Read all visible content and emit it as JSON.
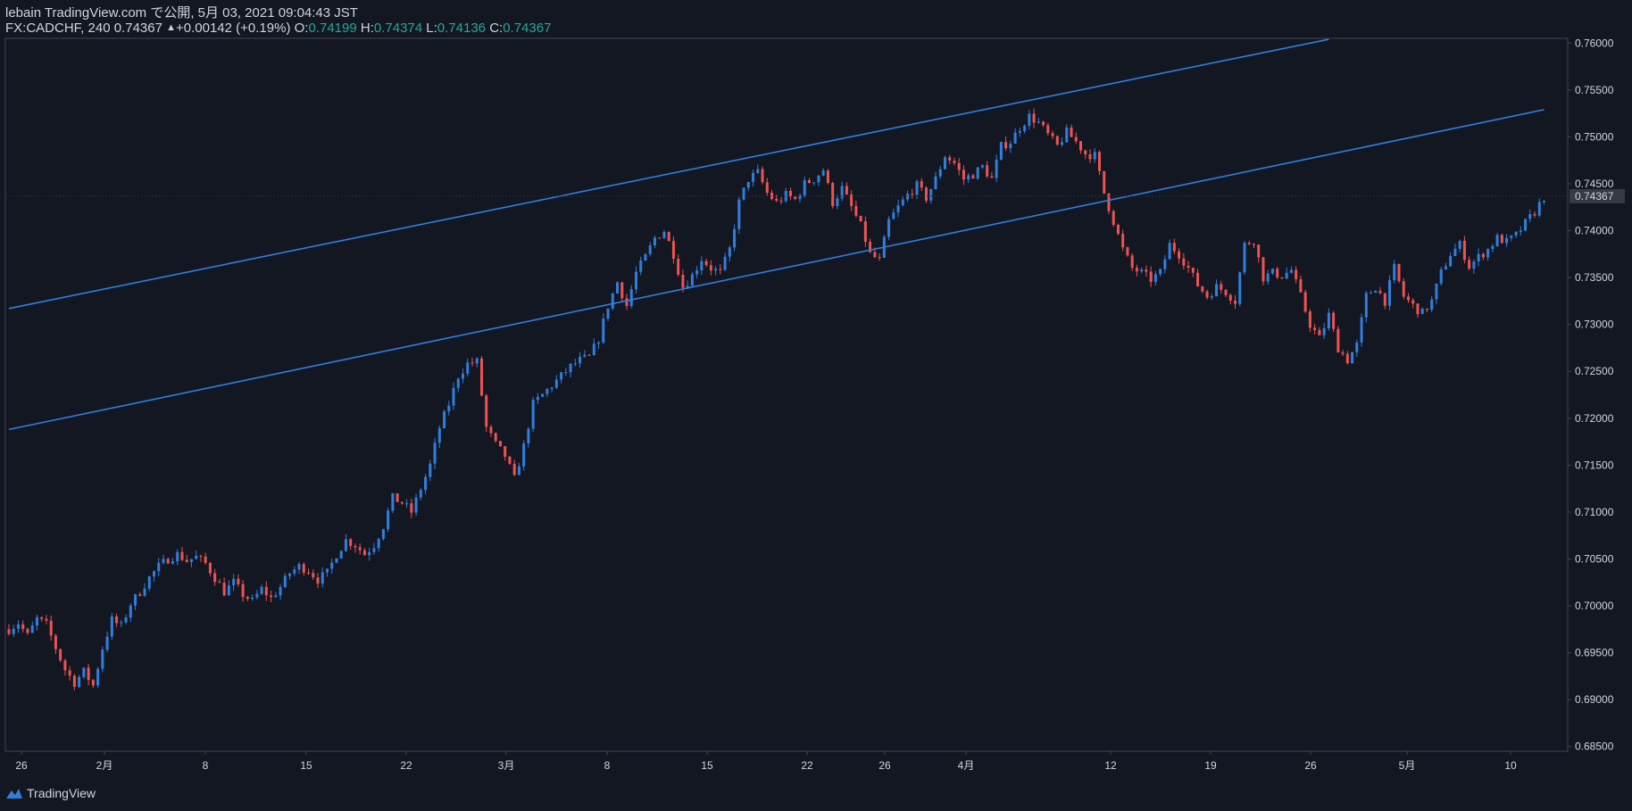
{
  "header": {
    "title": "lebain TradingView.com で公開, 5月 03, 2021 09:04:43 JST",
    "symbol_interval": "FX:CADCHF, 240",
    "last": "0.74367",
    "change": "+0.00142 (+0.19%)",
    "o_label": "O:",
    "o_value": "0.74199",
    "h_label": "H:",
    "h_value": "0.74374",
    "l_label": "L:",
    "l_value": "0.74136",
    "c_label": "C:",
    "c_value": "0.74367"
  },
  "footer": {
    "brand": "TradingView"
  },
  "colors": {
    "background": "#131722",
    "up": "#2f7fdf",
    "down": "#ef5350",
    "trendline": "#2f7fdf",
    "text": "#d1d4dc",
    "price_label_bg": "#363a45"
  },
  "chart_data": {
    "type": "candlestick",
    "symbol": "FX:CADCHF",
    "interval": "240",
    "y_range": [
      0.6845,
      0.7605
    ],
    "y_ticks": [
      "0.76000",
      "0.75500",
      "0.75000",
      "0.74500",
      "0.74000",
      "0.73500",
      "0.73000",
      "0.72500",
      "0.72000",
      "0.71500",
      "0.71000",
      "0.70500",
      "0.70000",
      "0.69500",
      "0.69000",
      "0.68500"
    ],
    "x_ticks": [
      "26",
      "2月",
      "8",
      "15",
      "22",
      "3月",
      "8",
      "15",
      "22",
      "26",
      "4月",
      "12",
      "19",
      "26",
      "5月",
      "10"
    ],
    "last_price_label": "0.74367",
    "close_path_note": "",
    "close_path": [
      [
        0,
        0.6975
      ],
      [
        2,
        0.6982
      ],
      [
        4,
        0.6968
      ],
      [
        6,
        0.6986
      ],
      [
        8,
        0.698
      ],
      [
        10,
        0.6955
      ],
      [
        12,
        0.6932
      ],
      [
        14,
        0.6918
      ],
      [
        16,
        0.693
      ],
      [
        18,
        0.6915
      ],
      [
        20,
        0.6955
      ],
      [
        22,
        0.6985
      ],
      [
        24,
        0.6978
      ],
      [
        26,
        0.7002
      ],
      [
        28,
        0.7015
      ],
      [
        30,
        0.703
      ],
      [
        32,
        0.7042
      ],
      [
        34,
        0.705
      ],
      [
        36,
        0.7055
      ],
      [
        38,
        0.7048
      ],
      [
        40,
        0.7052
      ],
      [
        42,
        0.7045
      ],
      [
        44,
        0.703
      ],
      [
        46,
        0.7015
      ],
      [
        48,
        0.7025
      ],
      [
        50,
        0.7012
      ],
      [
        52,
        0.7005
      ],
      [
        54,
        0.7018
      ],
      [
        56,
        0.7008
      ],
      [
        58,
        0.702
      ],
      [
        60,
        0.7035
      ],
      [
        62,
        0.7042
      ],
      [
        64,
        0.7038
      ],
      [
        66,
        0.7028
      ],
      [
        68,
        0.7035
      ],
      [
        70,
        0.7055
      ],
      [
        72,
        0.707
      ],
      [
        74,
        0.7065
      ],
      [
        76,
        0.7055
      ],
      [
        78,
        0.7065
      ],
      [
        80,
        0.7085
      ],
      [
        82,
        0.7115
      ],
      [
        84,
        0.711
      ],
      [
        86,
        0.71
      ],
      [
        88,
        0.7125
      ],
      [
        90,
        0.715
      ],
      [
        92,
        0.719
      ],
      [
        94,
        0.7215
      ],
      [
        96,
        0.7245
      ],
      [
        98,
        0.7258
      ],
      [
        100,
        0.726
      ],
      [
        102,
        0.719
      ],
      [
        104,
        0.7172
      ],
      [
        106,
        0.716
      ],
      [
        108,
        0.7135
      ],
      [
        110,
        0.717
      ],
      [
        112,
        0.7215
      ],
      [
        114,
        0.7225
      ],
      [
        116,
        0.7235
      ],
      [
        118,
        0.7245
      ],
      [
        120,
        0.7255
      ],
      [
        122,
        0.7262
      ],
      [
        124,
        0.7265
      ],
      [
        126,
        0.7285
      ],
      [
        128,
        0.732
      ],
      [
        130,
        0.7345
      ],
      [
        132,
        0.732
      ],
      [
        134,
        0.7355
      ],
      [
        136,
        0.7372
      ],
      [
        138,
        0.7392
      ],
      [
        140,
        0.74
      ],
      [
        142,
        0.7375
      ],
      [
        144,
        0.734
      ],
      [
        146,
        0.7352
      ],
      [
        148,
        0.737
      ],
      [
        150,
        0.736
      ],
      [
        152,
        0.7355
      ],
      [
        154,
        0.738
      ],
      [
        156,
        0.743
      ],
      [
        158,
        0.7455
      ],
      [
        160,
        0.7462
      ],
      [
        162,
        0.744
      ],
      [
        164,
        0.743
      ],
      [
        166,
        0.7438
      ],
      [
        168,
        0.7433
      ],
      [
        170,
        0.745
      ],
      [
        172,
        0.7455
      ],
      [
        174,
        0.7465
      ],
      [
        176,
        0.743
      ],
      [
        178,
        0.7445
      ],
      [
        180,
        0.7425
      ],
      [
        182,
        0.7405
      ],
      [
        184,
        0.7375
      ],
      [
        186,
        0.7368
      ],
      [
        188,
        0.741
      ],
      [
        190,
        0.7425
      ],
      [
        192,
        0.7438
      ],
      [
        194,
        0.7448
      ],
      [
        196,
        0.7435
      ],
      [
        198,
        0.7455
      ],
      [
        200,
        0.748
      ],
      [
        202,
        0.7472
      ],
      [
        204,
        0.7455
      ],
      [
        206,
        0.746
      ],
      [
        208,
        0.7468
      ],
      [
        210,
        0.7455
      ],
      [
        212,
        0.749
      ],
      [
        214,
        0.7495
      ],
      [
        216,
        0.751
      ],
      [
        218,
        0.7522
      ],
      [
        220,
        0.7515
      ],
      [
        222,
        0.7502
      ],
      [
        224,
        0.749
      ],
      [
        226,
        0.7505
      ],
      [
        228,
        0.7495
      ],
      [
        230,
        0.7482
      ],
      [
        232,
        0.748
      ],
      [
        234,
        0.744
      ],
      [
        236,
        0.741
      ],
      [
        238,
        0.738
      ],
      [
        240,
        0.736
      ],
      [
        242,
        0.7355
      ],
      [
        244,
        0.7348
      ],
      [
        246,
        0.7355
      ],
      [
        248,
        0.7385
      ],
      [
        250,
        0.7375
      ],
      [
        252,
        0.736
      ],
      [
        254,
        0.7342
      ],
      [
        256,
        0.733
      ],
      [
        258,
        0.734
      ],
      [
        260,
        0.7335
      ],
      [
        262,
        0.7325
      ],
      [
        264,
        0.7385
      ],
      [
        266,
        0.739
      ],
      [
        268,
        0.735
      ],
      [
        270,
        0.7355
      ],
      [
        272,
        0.7352
      ],
      [
        274,
        0.7358
      ],
      [
        276,
        0.733
      ],
      [
        278,
        0.73
      ],
      [
        280,
        0.7285
      ],
      [
        282,
        0.731
      ],
      [
        284,
        0.7275
      ],
      [
        286,
        0.7262
      ],
      [
        288,
        0.7278
      ],
      [
        290,
        0.733
      ],
      [
        292,
        0.734
      ],
      [
        294,
        0.7325
      ],
      [
        296,
        0.736
      ],
      [
        298,
        0.733
      ],
      [
        300,
        0.732
      ],
      [
        302,
        0.7312
      ],
      [
        304,
        0.7325
      ],
      [
        306,
        0.7355
      ],
      [
        308,
        0.7375
      ],
      [
        310,
        0.7385
      ],
      [
        312,
        0.7362
      ],
      [
        314,
        0.7372
      ],
      [
        316,
        0.738
      ],
      [
        318,
        0.7392
      ],
      [
        320,
        0.7388
      ],
      [
        322,
        0.7395
      ],
      [
        324,
        0.7408
      ],
      [
        326,
        0.742
      ],
      [
        328,
        0.7436
      ]
    ],
    "trendlines": [
      {
        "name": "upper channel",
        "p1": [
          0,
          0.7317
        ],
        "p2": [
          282,
          0.7604
        ]
      },
      {
        "name": "lower channel",
        "p1": [
          0,
          0.7188
        ],
        "p2": [
          328,
          0.7529
        ]
      }
    ]
  }
}
